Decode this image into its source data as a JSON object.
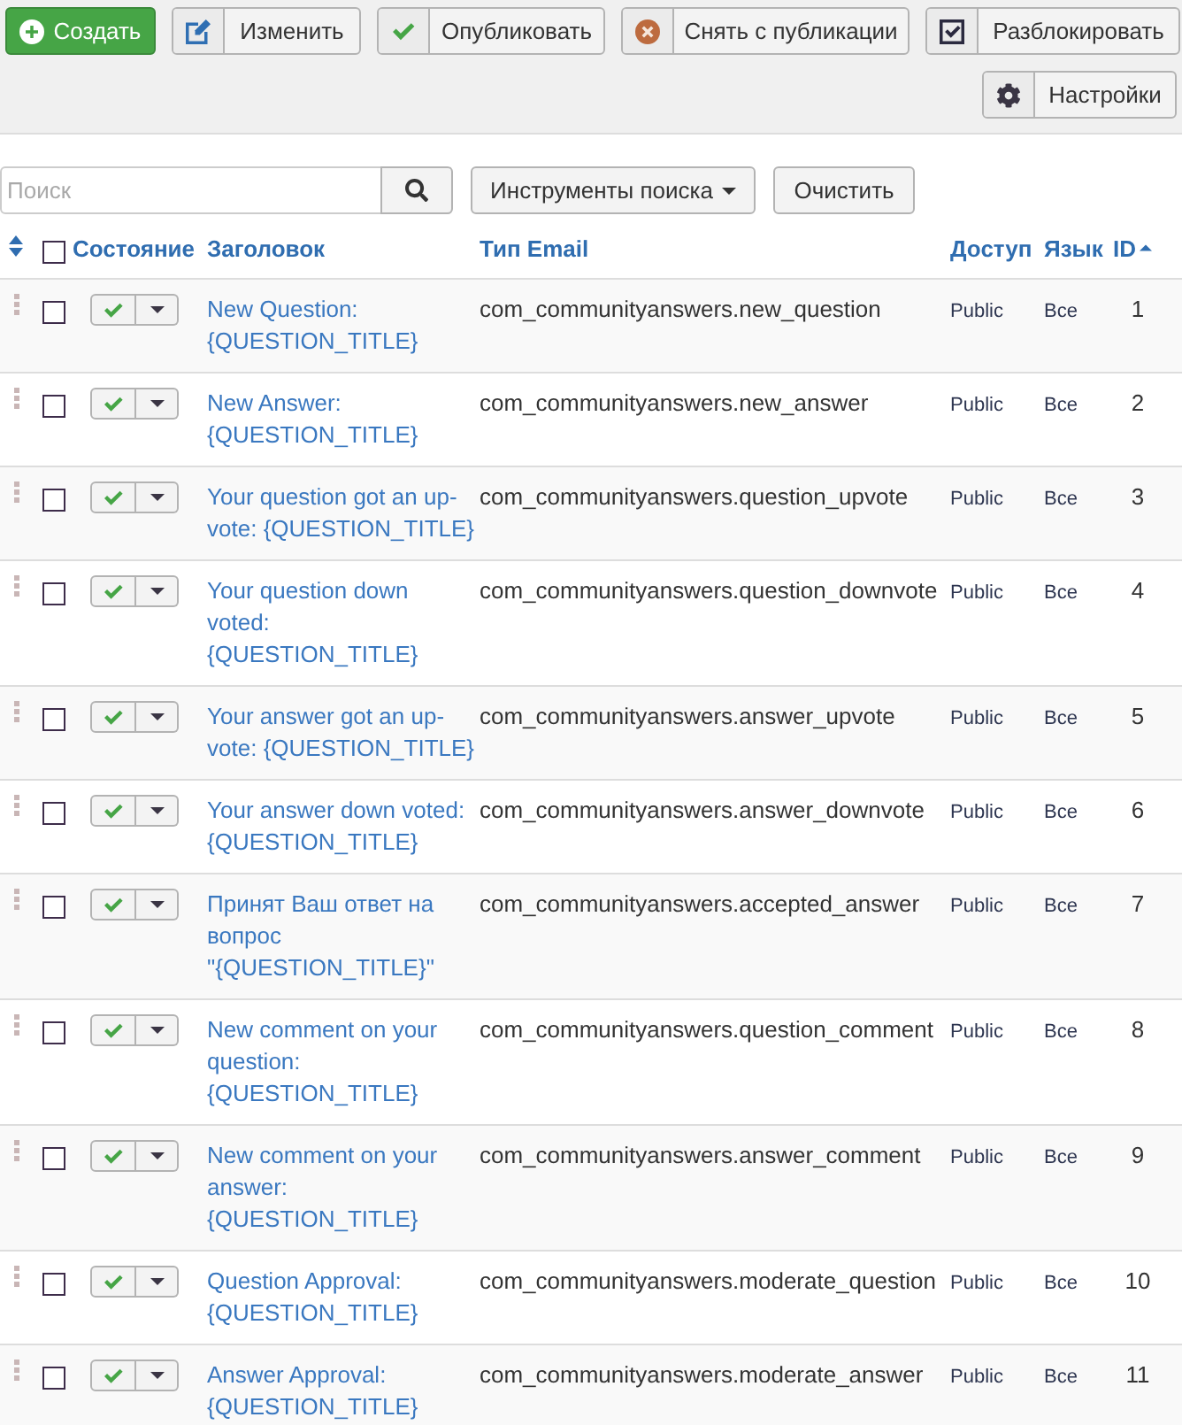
{
  "toolbar": {
    "buttons": [
      {
        "kind": "create",
        "label": "Создать"
      },
      {
        "kind": "edit",
        "label": "Изменить"
      },
      {
        "kind": "publish",
        "label": "Опубликовать"
      },
      {
        "kind": "unpublish",
        "label": "Снять с публикации"
      },
      {
        "kind": "checkin",
        "label": "Разблокировать"
      }
    ],
    "right_buttons": [
      {
        "kind": "options",
        "label": "Настройки"
      }
    ]
  },
  "search": {
    "placeholder": "Поиск",
    "tools_button": "Инструменты поиска",
    "clear_button": "Очистить"
  },
  "table": {
    "header_checkbox": {
      "checked": false
    },
    "columns": [
      {
        "label": "Состояние",
        "sorted": false
      },
      {
        "label": "Заголовок",
        "sorted": false
      },
      {
        "label": "Тип Email",
        "sorted": false
      },
      {
        "label": "Доступ",
        "sorted": false
      },
      {
        "label": "Язык",
        "sorted": false
      },
      {
        "label": "ID",
        "sorted": true
      }
    ],
    "rows": [
      {
        "title": "New Question: {QUESTION_TITLE}",
        "email_type": "com_communityanswers.new_question",
        "access": "Public",
        "language": "Все",
        "id": "1",
        "checked": false,
        "published": true
      },
      {
        "title": "New Answer: {QUESTION_TITLE}",
        "email_type": "com_communityanswers.new_answer",
        "access": "Public",
        "language": "Все",
        "id": "2",
        "checked": false,
        "published": true
      },
      {
        "title": "Your question got an up-vote: {QUESTION_TITLE}",
        "email_type": "com_communityanswers.question_upvote",
        "access": "Public",
        "language": "Все",
        "id": "3",
        "checked": false,
        "published": true
      },
      {
        "title": "Your question down voted: {QUESTION_TITLE}",
        "email_type": "com_communityanswers.question_downvote",
        "access": "Public",
        "language": "Все",
        "id": "4",
        "checked": false,
        "published": true
      },
      {
        "title": "Your answer got an up-vote: {QUESTION_TITLE}",
        "email_type": "com_communityanswers.answer_upvote",
        "access": "Public",
        "language": "Все",
        "id": "5",
        "checked": false,
        "published": true
      },
      {
        "title": "Your answer down voted: {QUESTION_TITLE}",
        "email_type": "com_communityanswers.answer_downvote",
        "access": "Public",
        "language": "Все",
        "id": "6",
        "checked": false,
        "published": true
      },
      {
        "title": "Принят Ваш ответ на вопрос \"{QUESTION_TITLE}\"",
        "email_type": "com_communityanswers.accepted_answer",
        "access": "Public",
        "language": "Все",
        "id": "7",
        "checked": false,
        "published": true
      },
      {
        "title": "New comment on your question: {QUESTION_TITLE}",
        "email_type": "com_communityanswers.question_comment",
        "access": "Public",
        "language": "Все",
        "id": "8",
        "checked": false,
        "published": true
      },
      {
        "title": "New comment on your answer: {QUESTION_TITLE}",
        "email_type": "com_communityanswers.answer_comment",
        "access": "Public",
        "language": "Все",
        "id": "9",
        "checked": false,
        "published": true
      },
      {
        "title": "Question Approval: {QUESTION_TITLE}",
        "email_type": "com_communityanswers.moderate_question",
        "access": "Public",
        "language": "Все",
        "id": "10",
        "checked": false,
        "published": true
      },
      {
        "title": "Answer Approval: {QUESTION_TITLE}",
        "email_type": "com_communityanswers.moderate_answer",
        "access": "Public",
        "language": "Все",
        "id": "11",
        "checked": false,
        "published": true
      }
    ]
  }
}
